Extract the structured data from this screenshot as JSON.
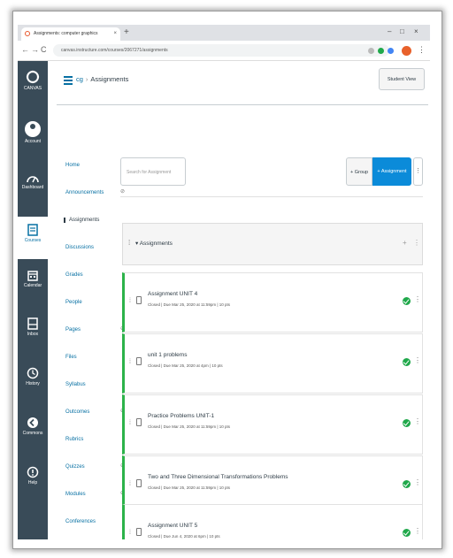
{
  "browser": {
    "tab_title": "Assignments: computer graphics",
    "tab_close": "×",
    "new_tab": "+",
    "url": "canvas.instructure.com/courses/2067271/assignments",
    "controls": {
      "minimize": "–",
      "maximize": "□",
      "close": "×"
    },
    "nav": {
      "back": "←",
      "forward": "→",
      "reload": "C"
    }
  },
  "global_nav": [
    {
      "label": "CANVAS",
      "icon": "canvas-logo"
    },
    {
      "label": "Account",
      "icon": "account-icon"
    },
    {
      "label": "Dashboard",
      "icon": "dashboard-icon"
    },
    {
      "label": "Courses",
      "icon": "courses-icon",
      "active": true
    },
    {
      "label": "Calendar",
      "icon": "calendar-icon"
    },
    {
      "label": "Inbox",
      "icon": "inbox-icon"
    },
    {
      "label": "History",
      "icon": "history-icon"
    },
    {
      "label": "Commons",
      "icon": "commons-icon"
    },
    {
      "label": "Help",
      "icon": "help-icon"
    }
  ],
  "header": {
    "breadcrumb_course": "cg",
    "breadcrumb_sep": "›",
    "breadcrumb_current": "Assignments",
    "student_view": "Student View"
  },
  "course_nav": [
    {
      "label": "Home"
    },
    {
      "label": "Announcements",
      "hidden": true
    },
    {
      "label": "Assignments",
      "active": true
    },
    {
      "label": "Discussions"
    },
    {
      "label": "Grades"
    },
    {
      "label": "People"
    },
    {
      "label": "Pages",
      "hidden": true
    },
    {
      "label": "Files"
    },
    {
      "label": "Syllabus"
    },
    {
      "label": "Outcomes",
      "hidden": true
    },
    {
      "label": "Rubrics"
    },
    {
      "label": "Quizzes",
      "hidden": true
    },
    {
      "label": "Modules",
      "hidden": true
    },
    {
      "label": "Conferences"
    }
  ],
  "toolbar": {
    "search_placeholder": "Search for Assignment",
    "group_button": "+ Group",
    "add_button": "+ Assignment",
    "more": "⋮"
  },
  "group": {
    "title": "▾ Assignments",
    "plus": "+",
    "more": "⋮",
    "items": [
      {
        "title": "Assignment UNIT 4",
        "meta": "Closed  |  Due Mar 25, 2020 at 11:59pm  |  10 pts"
      },
      {
        "title": "unit 1 problems",
        "meta": "Closed  |  Due Mar 25, 2020 at 4pm  |  10 pts"
      },
      {
        "title": "Practice Problems UNIT-1",
        "meta": "Closed  |  Due Mar 25, 2020 at 11:59pm  |  10 pts"
      },
      {
        "title": "Two and Three Dimensional Transformations Problems",
        "meta": "Closed  |  Due Mar 25, 2020 at 11:59pm  |  10 pts"
      },
      {
        "title": "Assignment UNIT 5",
        "meta": "Closed  |  Due Jun 4, 2020 at 6pm  |  10 pts"
      }
    ]
  },
  "colors": {
    "nav_bg": "#394b58",
    "link": "#0770a3",
    "primary_button": "#0b8bd9",
    "published": "#1fa84a"
  }
}
